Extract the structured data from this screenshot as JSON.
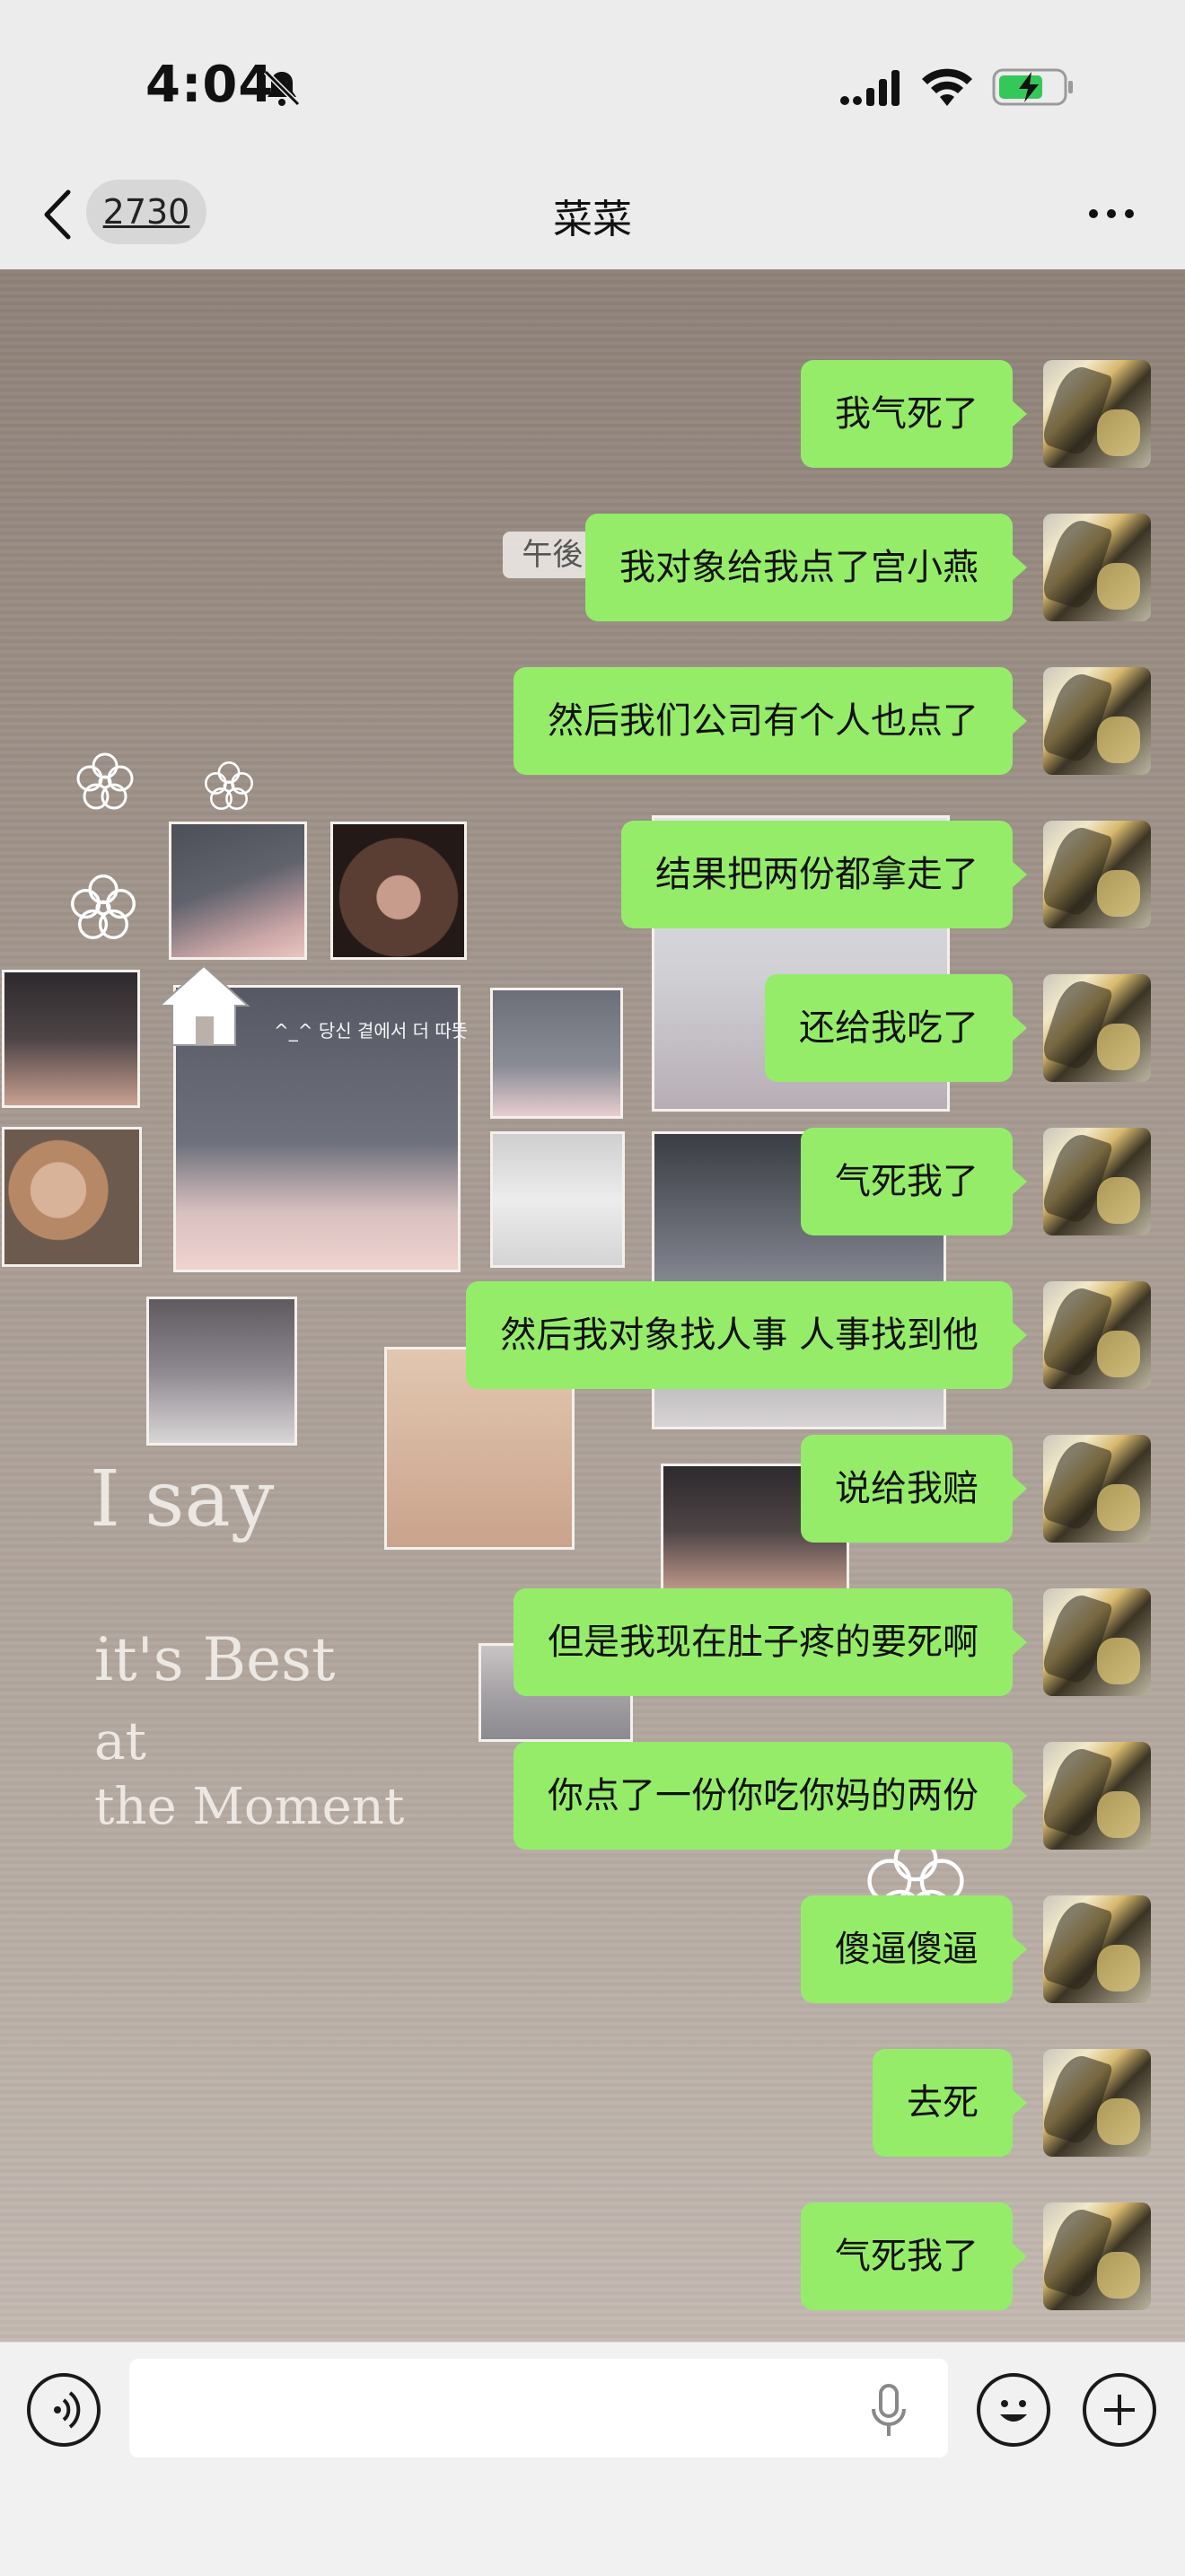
{
  "status_bar": {
    "time": "4:04",
    "icons": [
      "bell-mute-icon",
      "cellular-signal-icon",
      "wifi-icon",
      "battery-charging-icon"
    ],
    "battery_color": "#34c759"
  },
  "header": {
    "back_icon": "chevron-left-icon",
    "unread_count": "2730",
    "title": "菜菜",
    "more_icon": "more-dots-icon"
  },
  "chat": {
    "timestamp": "午後 4:04",
    "background_korean_text": "^_^ 당신 곁에서 더 따뜻",
    "handwriting": [
      "I say",
      "it's Best",
      "at",
      "the Moment"
    ],
    "bubble_color": "#95ec69",
    "messages": [
      {
        "text": "我气死了",
        "sender": "self"
      },
      {
        "text": "我对象给我点了宫小燕",
        "sender": "self"
      },
      {
        "text": "然后我们公司有个人也点了",
        "sender": "self"
      },
      {
        "text": "结果把两份都拿走了",
        "sender": "self"
      },
      {
        "text": "还给我吃了",
        "sender": "self"
      },
      {
        "text": "气死我了",
        "sender": "self"
      },
      {
        "text": "然后我对象找人事 人事找到他",
        "sender": "self"
      },
      {
        "text": "说给我赔",
        "sender": "self"
      },
      {
        "text": "但是我现在肚子疼的要死啊",
        "sender": "self"
      },
      {
        "text": "你点了一份你吃你妈的两份",
        "sender": "self"
      },
      {
        "text": "傻逼傻逼",
        "sender": "self"
      },
      {
        "text": "去死",
        "sender": "self"
      },
      {
        "text": "气死我了",
        "sender": "self"
      }
    ]
  },
  "input_bar": {
    "voice_icon": "voice-mode-icon",
    "mic_icon": "microphone-icon",
    "emoji_icon": "emoji-icon",
    "plus_icon": "plus-icon"
  }
}
